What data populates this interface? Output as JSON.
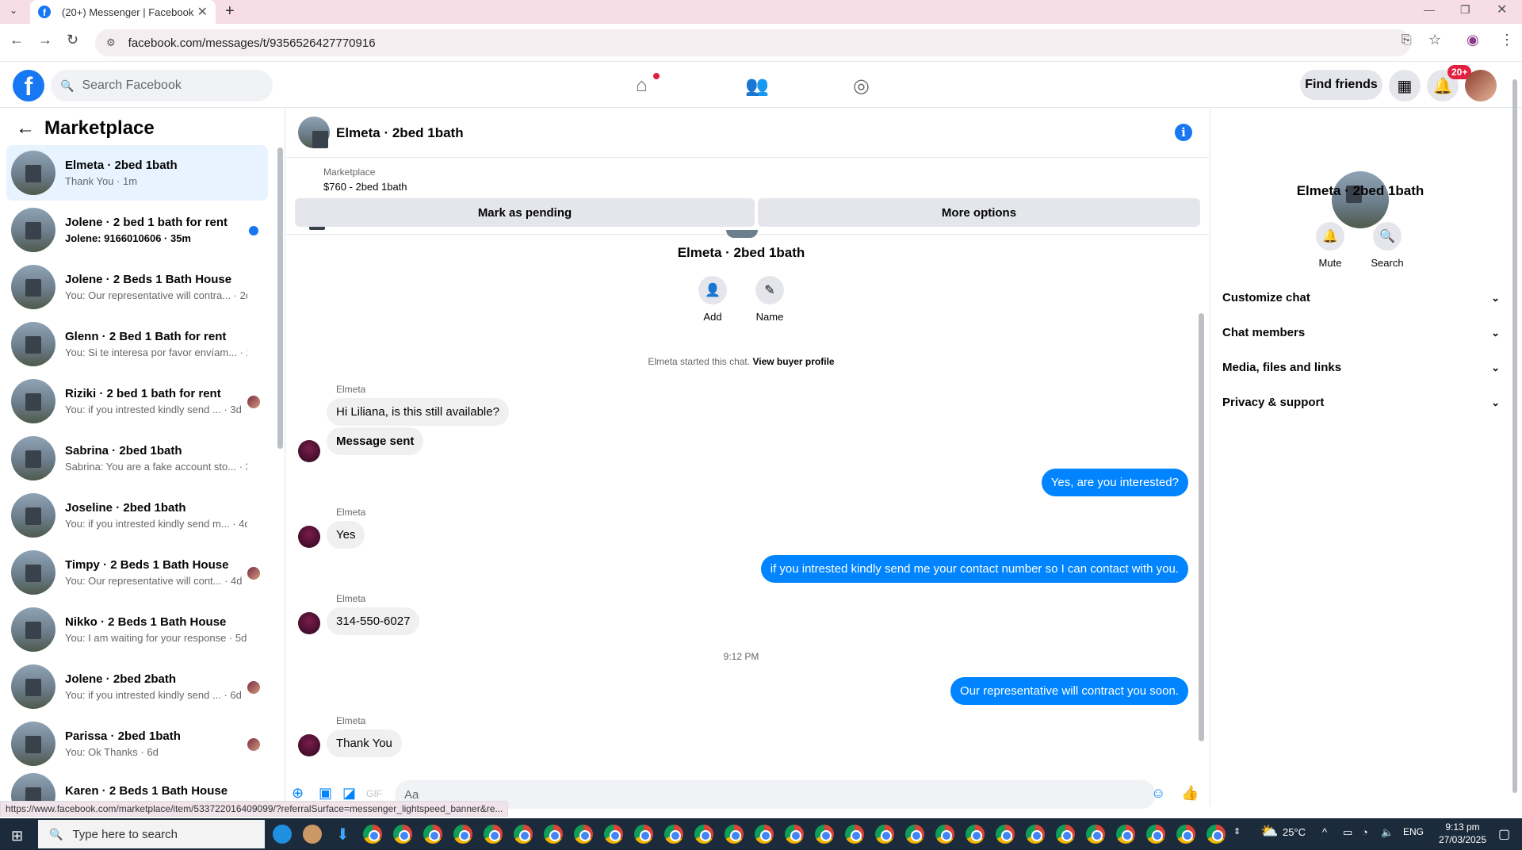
{
  "browser": {
    "tab_title": "(20+) Messenger | Facebook",
    "tab_close": "✕",
    "new_tab": "+",
    "url": "facebook.com/messages/t/9356526427770916"
  },
  "header": {
    "logo": "f",
    "search_placeholder": "Search Facebook",
    "find_friends": "Find friends",
    "notifications_badge": "20+"
  },
  "left_panel": {
    "title": "Marketplace",
    "conversations": [
      {
        "title": "Elmeta · 2bed 1bath",
        "subtitle": "Thank You · 1m",
        "selected": true
      },
      {
        "title": "Jolene · 2 bed 1 bath for rent",
        "subtitle": "Jolene: 9166010606 · 35m",
        "unread": true
      },
      {
        "title": "Jolene · 2 Beds 1 Bath House",
        "subtitle": "You: Our representative will contra... · 2d"
      },
      {
        "title": "Glenn · 2 Bed 1 Bath for rent",
        "subtitle": "You: Si te interesa por favor envíam... · 2d"
      },
      {
        "title": "Riziki · 2 bed 1 bath for rent",
        "subtitle": "You: if you intrested kindly send ... · 3d"
      },
      {
        "title": "Sabrina · 2bed 1bath",
        "subtitle": "Sabrina: You are a fake account sto... · 3d"
      },
      {
        "title": "Joseline · 2bed 1bath",
        "subtitle": "You: if you intrested kindly send m... · 4d"
      },
      {
        "title": "Timpy · 2 Beds 1 Bath House",
        "subtitle": "You: Our representative will cont... · 4d"
      },
      {
        "title": "Nikko · 2 Beds 1 Bath House",
        "subtitle": "You: I am waiting for your response · 5d"
      },
      {
        "title": "Jolene · 2bed 2bath",
        "subtitle": "You: if you intrested kindly send ... · 6d"
      },
      {
        "title": "Parissa · 2bed 1bath",
        "subtitle": "You: Ok Thanks · 6d"
      },
      {
        "title": "Karen · 2 Beds 1 Bath House",
        "subtitle": ""
      }
    ]
  },
  "chat": {
    "name": "Elmeta · 2bed 1bath",
    "marketplace_label": "Marketplace",
    "listing": "$760 - 2bed 1bath",
    "mark_pending": "Mark as pending",
    "more_options": "More options",
    "profile_name": "Elmeta · 2bed 1bath",
    "add_label": "Add",
    "name_label": "Name",
    "started_text": "Elmeta started this chat.",
    "view_buyer_profile": "View buyer profile",
    "sender": "Elmeta",
    "messages": {
      "m1": "Hi Liliana, is this still available?",
      "m2": "Message sent",
      "m3": "Yes, are you interested?",
      "m4": "Yes",
      "m5": "if you intrested kindly send me your contact number so I can contact with you.",
      "m6": "314-550-6027",
      "m7": "Our representative will contract you soon.",
      "m8": "Thank You"
    },
    "time_separator": "9:12 PM",
    "composer_placeholder": "Aa"
  },
  "right_panel": {
    "name": "Elmeta · 2bed 1bath",
    "mute": "Mute",
    "search": "Search",
    "sections": [
      "Customize chat",
      "Chat members",
      "Media, files and links",
      "Privacy & support"
    ]
  },
  "status_url": "https://www.facebook.com/marketplace/item/533722016409099/?referralSurface=messenger_lightspeed_banner&re...",
  "taskbar": {
    "search_placeholder": "Type here to search",
    "temperature": "25°C",
    "language": "ENG",
    "time": "9:13 pm",
    "date": "27/03/2025"
  },
  "colors": {
    "brand": "#1877f2",
    "outgoing": "#0084ff",
    "badge": "#e41e3f"
  }
}
